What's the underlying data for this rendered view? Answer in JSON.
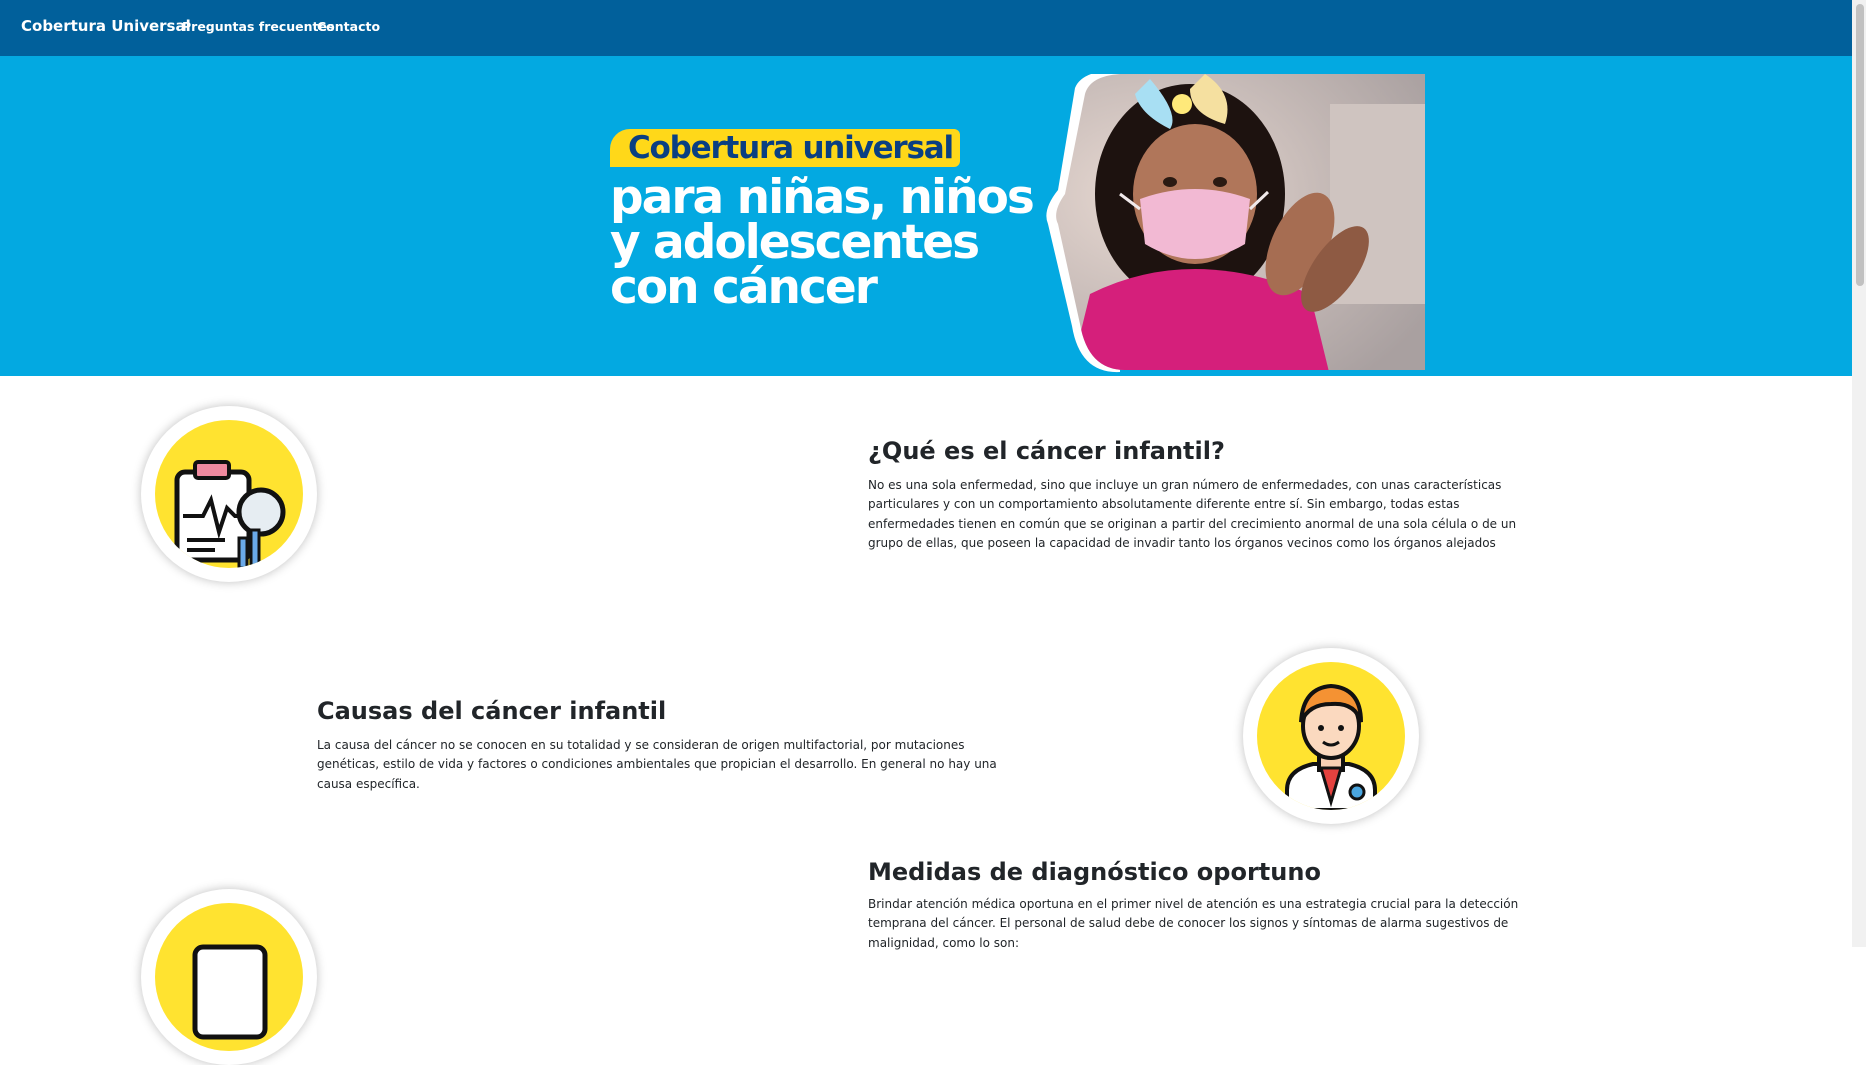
{
  "nav": {
    "brand": "Cobertura Universal",
    "links": [
      "Preguntas frecuentes",
      "Contacto"
    ]
  },
  "hero": {
    "banner": "Cobertura universal",
    "lines": [
      "para niñas, niños",
      "y adolescentes",
      "con cáncer"
    ]
  },
  "sections": [
    {
      "title": "¿Qué es el cáncer infantil?",
      "text": "No es una sola enfermedad, sino que incluye un gran número de enfermedades, con unas características particulares y con un comportamiento absolutamente diferente entre sí. Sin embargo, todas estas enfermedades tienen en común que se originan a partir del crecimiento anormal de una sola célula o de un grupo de ellas, que poseen la capacidad de invadir tanto los órganos vecinos como los órganos alejados",
      "icon": "medical-report-icon"
    },
    {
      "title": "Causas del cáncer infantil",
      "text": "La causa del cáncer no se conocen en su totalidad y se consideran de origen multifactorial, por mutaciones genéticas, estilo de vida y factores o condiciones ambientales que propician el desarrollo. En general no hay una causa específica.",
      "icon": "doctor-icon"
    },
    {
      "title": "Medidas de diagnóstico oportuno",
      "text": "Brindar atención médica oportuna en el primer nivel de atención es una estrategia crucial para la detección temprana del cáncer. El personal de salud debe de conocer los signos y síntomas de alarma sugestivos de malignidad, como lo son:",
      "icon": "clipboard-icon"
    }
  ],
  "colors": {
    "navbar": "#01609b",
    "hero": "#03a9e1",
    "accent_yellow": "#ffd819",
    "banner_text": "#0a3f82"
  }
}
